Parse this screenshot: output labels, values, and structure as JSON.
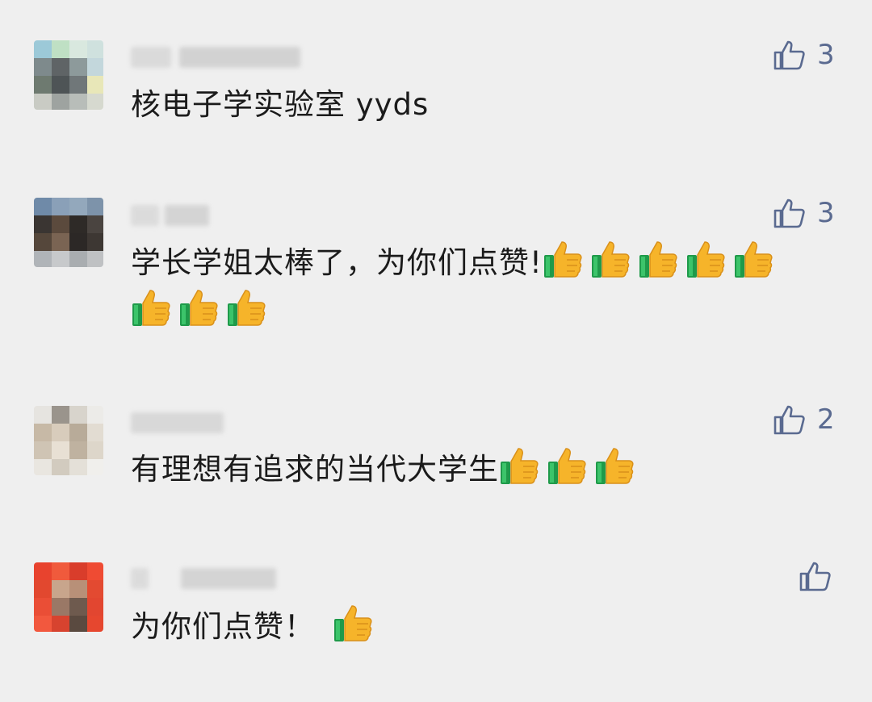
{
  "comments": [
    {
      "text": "核电子学实验室 yyds",
      "emoji_count": 0,
      "likes": "3",
      "avatar": [
        "#9cc9d8",
        "#bfe0c4",
        "#d9e8df",
        "#cfe1de",
        "#7e8a8c",
        "#5f6466",
        "#8d9a9b",
        "#c3d7dc",
        "#6e7a70",
        "#4e5456",
        "#707779",
        "#e8e7b8",
        "#c9cbc4",
        "#9ea3a0",
        "#b8bdb9",
        "#d6d9cf"
      ]
    },
    {
      "text": "学长学姐太棒了，为你们点赞!",
      "emoji_count": 8,
      "likes": "3",
      "avatar": [
        "#6f8aa8",
        "#8aa0b8",
        "#93a8bc",
        "#7d93aa",
        "#3a3532",
        "#5b4a3d",
        "#2e2a27",
        "#4a4440",
        "#55473b",
        "#7a6453",
        "#2c2826",
        "#3d3733",
        "#b0b4b8",
        "#c7c9cb",
        "#a9adb0",
        "#bfc1c3"
      ]
    },
    {
      "text": "有理想有追求的当代大学生",
      "emoji_count": 3,
      "likes": "2",
      "avatar": [
        "#e6e4e0",
        "#9a948c",
        "#d8d4cc",
        "#ecebe8",
        "#c7b9a6",
        "#d8ccbc",
        "#b8ab99",
        "#e2dcd2",
        "#cfc4b4",
        "#e8e0d4",
        "#bfb2a0",
        "#ddd6ca",
        "#e9e6e0",
        "#d2cbbf",
        "#e4e0d8",
        "#f0efec"
      ]
    },
    {
      "text": "为你们点赞！",
      "emoji_count": 1,
      "likes": "",
      "avatar": [
        "#e8432e",
        "#f05a3c",
        "#d93d2b",
        "#ef4b33",
        "#e2482f",
        "#c8a58c",
        "#b89078",
        "#e34a31",
        "#ea4e36",
        "#9a7866",
        "#6e5a4e",
        "#e24630",
        "#f2583e",
        "#d7432f",
        "#5a4a40",
        "#e6472f"
      ]
    }
  ],
  "icons": {
    "like": "thumbs-up-outline-icon",
    "emoji": "thumbs-up-emoji-icon"
  },
  "colors": {
    "background": "#efefef",
    "like": "#5a6a90",
    "text": "#1b1b1b"
  }
}
